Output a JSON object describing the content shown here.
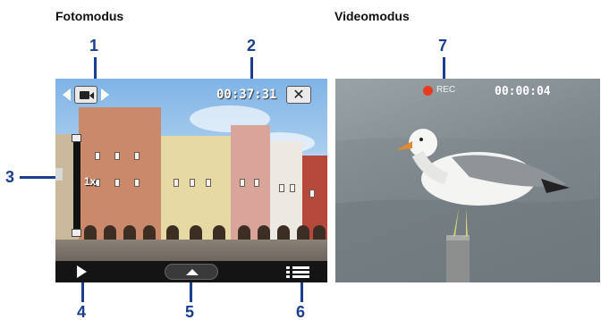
{
  "headings": {
    "photo": "Fotomodus",
    "video": "Videomodus"
  },
  "callouts": [
    "1",
    "2",
    "3",
    "4",
    "5",
    "6",
    "7"
  ],
  "photo_panel": {
    "remaining_time": "00:37:31",
    "zoom_level": "1x",
    "icons": {
      "prev": "triangle-left-icon",
      "mode": "video-camera-icon",
      "next": "triangle-right-icon",
      "close": "close-icon",
      "play": "play-icon",
      "up": "chevron-up-icon",
      "menu": "menu-list-icon"
    },
    "close_label": "✕"
  },
  "video_panel": {
    "rec_label": "REC",
    "rec_time": "00:00:04"
  },
  "colors": {
    "callout": "#1b3f8f",
    "rec": "#e63b1e",
    "bar": "#141414"
  }
}
